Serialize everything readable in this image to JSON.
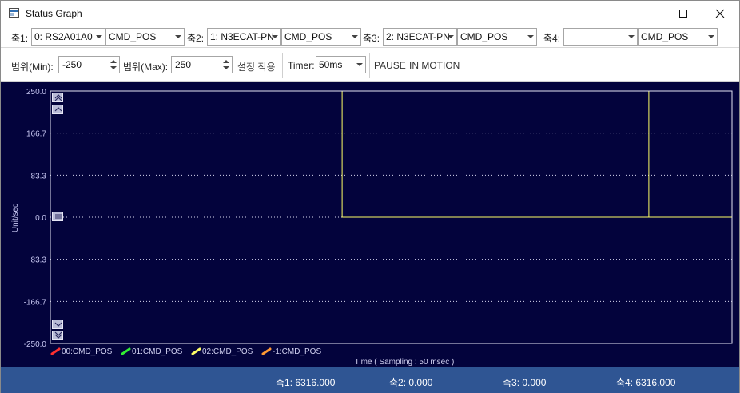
{
  "window": {
    "title": "Status Graph"
  },
  "axes_bar": [
    {
      "label": "축1:",
      "device": "0: RS2A01A0",
      "signal": "CMD_POS"
    },
    {
      "label": "축2:",
      "device": "1: N3ECAT-PN",
      "signal": "CMD_POS"
    },
    {
      "label": "축3:",
      "device": "2: N3ECAT-PN",
      "signal": "CMD_POS"
    },
    {
      "label": "축4:",
      "device": "",
      "signal": "CMD_POS"
    }
  ],
  "range": {
    "min_label": "범위(Min):",
    "min_value": "-250",
    "max_label": "범위(Max):",
    "max_value": "250",
    "apply_label": "설정 적용"
  },
  "timer": {
    "label": "Timer:",
    "value": "50ms"
  },
  "controls": {
    "pause_label": "PAUSE",
    "in_motion_label": "IN MOTION"
  },
  "icons": [
    "window-icon",
    "minimize-icon",
    "maximize-icon",
    "close-icon",
    "chevron-down-icon",
    "spin-up-icon",
    "spin-down-icon",
    "zoom-up-icon",
    "zoom-reset-icon",
    "zoom-down-icon"
  ],
  "colors": {
    "plot_bg": "#03033c",
    "grid": "#d8d8f0",
    "series0": "#ff3030",
    "series1": "#33ee33",
    "series2": "#ffff66",
    "series3": "#ff9933",
    "status_bg": "#2f5593"
  },
  "chart_data": {
    "type": "line",
    "title": "",
    "ylabel": "Unit/sec",
    "xlabel": "Time ( Sampling : 50 msec )",
    "ylim": [
      -250,
      250
    ],
    "yticks": [
      "250.0",
      "166.7",
      "83.3",
      "0.0",
      "-83.3",
      "-166.7",
      "-250.0"
    ],
    "ytick_values": [
      250,
      166.7,
      83.3,
      0,
      -83.3,
      -166.7,
      -250
    ],
    "xlim": [
      0,
      100
    ],
    "grid": true,
    "legend_position": "bottom-left",
    "series": [
      {
        "name": "00:CMD_POS",
        "color": "#ff3030",
        "points": []
      },
      {
        "name": "01:CMD_POS",
        "color": "#33ee33",
        "points": []
      },
      {
        "name": "02:CMD_POS",
        "color": "#ffff66",
        "points": [
          [
            42.8,
            0
          ],
          [
            42.8,
            250
          ],
          [
            42.8,
            0
          ],
          [
            87.8,
            0
          ],
          [
            87.8,
            250
          ],
          [
            87.8,
            0
          ],
          [
            100,
            0
          ]
        ]
      },
      {
        "name": "-1:CMD_POS",
        "color": "#ff9933",
        "points": []
      }
    ]
  },
  "statusbar": [
    {
      "text": "축1: 6316.000"
    },
    {
      "text": "축2: 0.000"
    },
    {
      "text": "축3: 0.000"
    },
    {
      "text": "축4: 6316.000"
    }
  ]
}
